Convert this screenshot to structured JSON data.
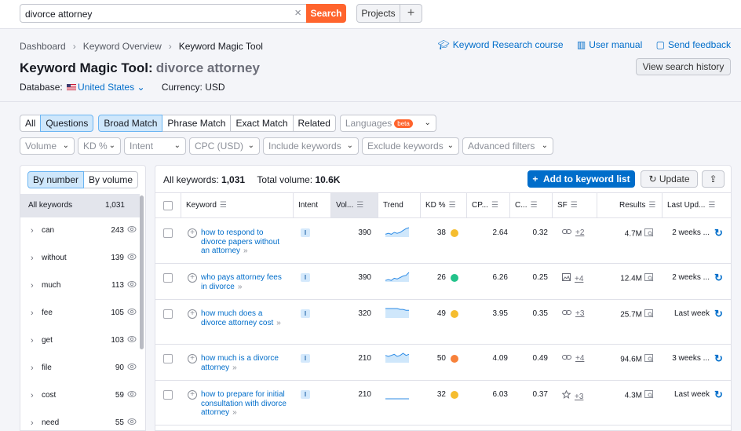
{
  "topbar": {
    "search_value": "divorce attorney",
    "search_button": "Search",
    "projects_button": "Projects",
    "plus_button": "+"
  },
  "breadcrumb": [
    "Dashboard",
    "Keyword Overview",
    "Keyword Magic Tool"
  ],
  "links": {
    "course": "Keyword Research course",
    "manual": "User manual",
    "feedback": "Send feedback"
  },
  "title": {
    "tool": "Keyword Magic Tool:",
    "query": "divorce attorney"
  },
  "history_button": "View search history",
  "database": {
    "label": "Database:",
    "value": "United States",
    "currency_label": "Currency: USD"
  },
  "match_tabs": [
    {
      "label": "All",
      "active": false
    },
    {
      "label": "Questions",
      "active": true
    }
  ],
  "match_type_tabs": [
    {
      "label": "Broad Match",
      "active": true
    },
    {
      "label": "Phrase Match",
      "active": false
    },
    {
      "label": "Exact Match",
      "active": false
    },
    {
      "label": "Related",
      "active": false
    }
  ],
  "languages": {
    "label": "Languages",
    "badge": "beta"
  },
  "filters": [
    "Volume",
    "KD %",
    "Intent",
    "CPC (USD)",
    "Include keywords",
    "Exclude keywords",
    "Advanced filters"
  ],
  "sidebar": {
    "toggle": [
      "By number",
      "By volume"
    ],
    "all_keywords_label": "All keywords",
    "all_keywords_count": "1,031",
    "groups": [
      {
        "label": "can",
        "count": "243"
      },
      {
        "label": "without",
        "count": "139"
      },
      {
        "label": "much",
        "count": "113"
      },
      {
        "label": "fee",
        "count": "105"
      },
      {
        "label": "get",
        "count": "103"
      },
      {
        "label": "file",
        "count": "90"
      },
      {
        "label": "cost",
        "count": "59"
      },
      {
        "label": "need",
        "count": "55"
      }
    ]
  },
  "summary": {
    "all_keywords_label": "All keywords:",
    "all_keywords_value": "1,031",
    "total_volume_label": "Total volume:",
    "total_volume_value": "10.6K"
  },
  "actions": {
    "add_to_list": "Add to keyword list",
    "update": "Update"
  },
  "columns": [
    "Keyword",
    "Intent",
    "Vol...",
    "Trend",
    "KD %",
    "CP...",
    "C...",
    "SF",
    "Results",
    "Last Upd..."
  ],
  "rows": [
    {
      "keyword": "how to respond to divorce papers without an attorney",
      "intent": "I",
      "volume": "390",
      "kd": "38",
      "kd_color": "#f5bd2f",
      "cpc": "2.64",
      "com": "0.32",
      "sf_icon": "link-icon",
      "sf_count": "+2",
      "results": "4.7M",
      "updated": "2 weeks ...",
      "trend": [
        3,
        4,
        3,
        5,
        4,
        5,
        7,
        9,
        10
      ]
    },
    {
      "keyword": "who pays attorney fees in divorce",
      "intent": "I",
      "volume": "390",
      "kd": "26",
      "kd_color": "#22c28a",
      "cpc": "6.26",
      "com": "0.25",
      "sf_icon": "image-icon",
      "sf_count": "+4",
      "results": "12.4M",
      "updated": "2 weeks ...",
      "trend": [
        2,
        3,
        2,
        5,
        4,
        6,
        8,
        9,
        13
      ]
    },
    {
      "keyword": "how much does a divorce attorney cost",
      "intent": "I",
      "volume": "320",
      "kd": "49",
      "kd_color": "#f5bd2f",
      "cpc": "3.95",
      "com": "0.35",
      "sf_icon": "link-icon",
      "sf_count": "+3",
      "results": "25.7M",
      "updated": "Last week",
      "trend": [
        11,
        11,
        11,
        11,
        11,
        10,
        10,
        9,
        9
      ]
    },
    {
      "keyword": "how much is a divorce attorney",
      "intent": "I",
      "volume": "210",
      "kd": "50",
      "kd_color": "#f7813a",
      "cpc": "4.09",
      "com": "0.49",
      "sf_icon": "link-icon",
      "sf_count": "+4",
      "results": "94.6M",
      "updated": "3 weeks ...",
      "trend": [
        7,
        6,
        7,
        8,
        6,
        7,
        9,
        7,
        8
      ]
    },
    {
      "keyword": "how to prepare for initial consultation with divorce attorney",
      "intent": "I",
      "volume": "210",
      "kd": "32",
      "kd_color": "#f5bd2f",
      "cpc": "6.03",
      "com": "0.37",
      "sf_icon": "star-icon",
      "sf_count": "+3",
      "results": "4.3M",
      "updated": "Last week",
      "trend": [
        0,
        0,
        0,
        0,
        0,
        0,
        0,
        0,
        0
      ]
    }
  ]
}
